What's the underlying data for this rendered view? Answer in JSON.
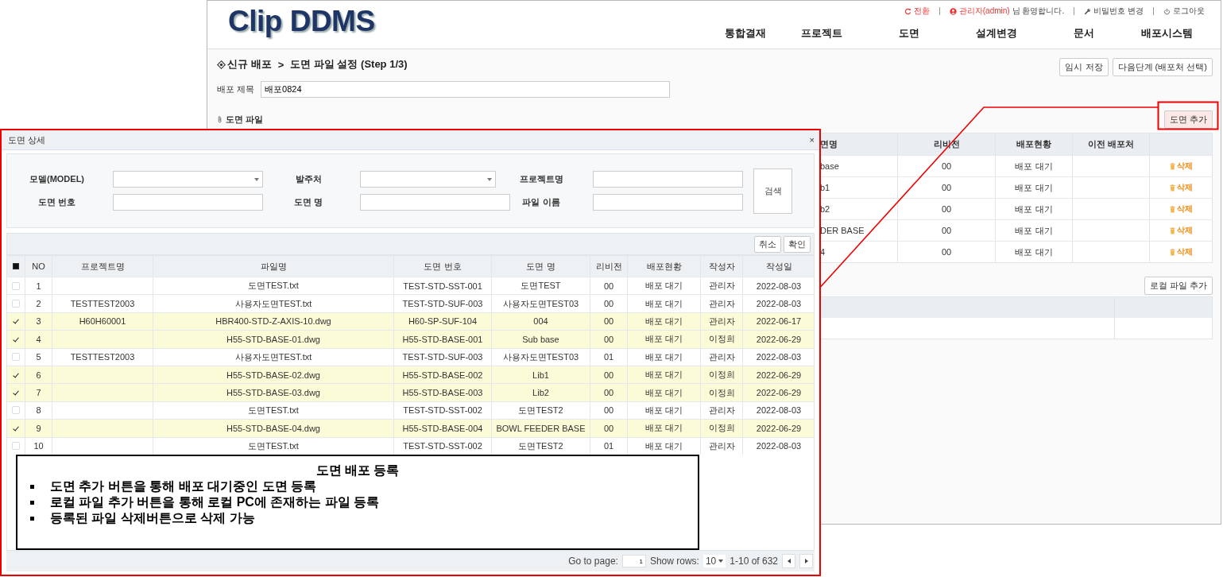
{
  "app": {
    "logo": "Clip DDMS",
    "top_links": [
      {
        "kind": "refresh",
        "label": "전환"
      },
      {
        "kind": "user",
        "label": "관리자(admin)",
        "note": "님 환영합니다."
      },
      {
        "kind": "wrench",
        "label": "비밀번호 변경"
      },
      {
        "kind": "power",
        "label": "로그아웃"
      }
    ],
    "nav": [
      "통합결재",
      "프로젝트",
      "도면",
      "설계변경",
      "문서",
      "배포시스템"
    ],
    "breadcrumb": {
      "items": [
        "신규 배포",
        "도면 파일 설정 (Step 1/3)"
      ],
      "separator": ">"
    },
    "actions": [
      "임시 저장",
      "다음단계 (배포처 선택)"
    ],
    "title_field": {
      "label": "배포 제목",
      "value": "배포0824"
    },
    "file_section": {
      "title": "도면 파일",
      "add_button": "도면 추가",
      "columns": [
        "면명",
        "리비전",
        "배포현황",
        "이전 배포처"
      ],
      "rows": [
        {
          "column_1": "base",
          "revision": "00",
          "status": "배포 대기",
          "delete": "삭제"
        },
        {
          "column_1": "b1",
          "revision": "00",
          "status": "배포 대기",
          "delete": "삭제"
        },
        {
          "column_1": "b2",
          "revision": "00",
          "status": "배포 대기",
          "delete": "삭제"
        },
        {
          "column_1": "DER BASE",
          "revision": "00",
          "status": "배포 대기",
          "delete": "삭제"
        },
        {
          "column_1": "4",
          "revision": "00",
          "status": "배포 대기",
          "delete": "삭제"
        }
      ]
    },
    "local_section": {
      "add_button": "로컬 파일 추가"
    }
  },
  "modal": {
    "title": "도면 상세",
    "close": "×",
    "filters": [
      {
        "label": "모델(MODEL)",
        "kind": "select"
      },
      {
        "label": "발주처",
        "kind": "select"
      },
      {
        "label": "프로젝트명",
        "kind": "input"
      },
      {
        "label": "도면 번호",
        "kind": "input"
      },
      {
        "label": "도면 명",
        "kind": "input"
      },
      {
        "label": "파일 이름",
        "kind": "input"
      }
    ],
    "search_button": "검색",
    "toolbar": [
      "취소",
      "확인"
    ],
    "grid": {
      "select_all_indeterminate": true,
      "columns": [
        "NO",
        "프로젝트명",
        "파일명",
        "도면 번호",
        "도면 명",
        "리비전",
        "배포현황",
        "작성자",
        "작성일"
      ],
      "rows": [
        {
          "checked": false,
          "cells": [
            "1",
            "",
            "도면TEST.txt",
            "TEST-STD-SST-001",
            "도면TEST",
            "00",
            "배포 대기",
            "관리자",
            "2022-08-03"
          ]
        },
        {
          "checked": false,
          "cells": [
            "2",
            "TESTTEST2003",
            "사용자도면TEST.txt",
            "TEST-STD-SUF-003",
            "사용자도면TEST03",
            "00",
            "배포 대기",
            "관리자",
            "2022-08-03"
          ]
        },
        {
          "checked": true,
          "cells": [
            "3",
            "H60H60001",
            "HBR400-STD-Z-AXIS-10.dwg",
            "H60-SP-SUF-104",
            "004",
            "00",
            "배포 대기",
            "관리자",
            "2022-06-17"
          ]
        },
        {
          "checked": true,
          "cells": [
            "4",
            "",
            "H55-STD-BASE-01.dwg",
            "H55-STD-BASE-001",
            "Sub base",
            "00",
            "배포 대기",
            "이정희",
            "2022-06-29"
          ]
        },
        {
          "checked": false,
          "cells": [
            "5",
            "TESTTEST2003",
            "사용자도면TEST.txt",
            "TEST-STD-SUF-003",
            "사용자도면TEST03",
            "01",
            "배포 대기",
            "관리자",
            "2022-08-03"
          ]
        },
        {
          "checked": true,
          "cells": [
            "6",
            "",
            "H55-STD-BASE-02.dwg",
            "H55-STD-BASE-002",
            "Lib1",
            "00",
            "배포 대기",
            "이정희",
            "2022-06-29"
          ]
        },
        {
          "checked": true,
          "cells": [
            "7",
            "",
            "H55-STD-BASE-03.dwg",
            "H55-STD-BASE-003",
            "Lib2",
            "00",
            "배포 대기",
            "이정희",
            "2022-06-29"
          ]
        },
        {
          "checked": false,
          "cells": [
            "8",
            "",
            "도면TEST.txt",
            "TEST-STD-SST-002",
            "도면TEST2",
            "00",
            "배포 대기",
            "관리자",
            "2022-08-03"
          ]
        },
        {
          "checked": true,
          "cells": [
            "9",
            "",
            "H55-STD-BASE-04.dwg",
            "H55-STD-BASE-004",
            "BOWL FEEDER BASE",
            "00",
            "배포 대기",
            "이정희",
            "2022-06-29"
          ]
        },
        {
          "checked": false,
          "cells": [
            "10",
            "",
            "도면TEST.txt",
            "TEST-STD-SST-002",
            "도면TEST2",
            "01",
            "배포 대기",
            "관리자",
            "2022-08-03"
          ]
        }
      ]
    },
    "pager": {
      "goto_label": "Go to page:",
      "page": "1",
      "rows_label": "Show rows:",
      "rows": "10",
      "range": "1-10 of 632"
    }
  },
  "annotation": {
    "title": "도면 배포 등록",
    "bullets": [
      "도면 추가 버튼을 통해 배포 대기중인 도면 등록",
      "로컬 파일 추가 버튼을 통해 로컬 PC에 존재하는 파일 등록",
      "등록된 파일 삭제버튼으로 삭제 가능"
    ]
  }
}
